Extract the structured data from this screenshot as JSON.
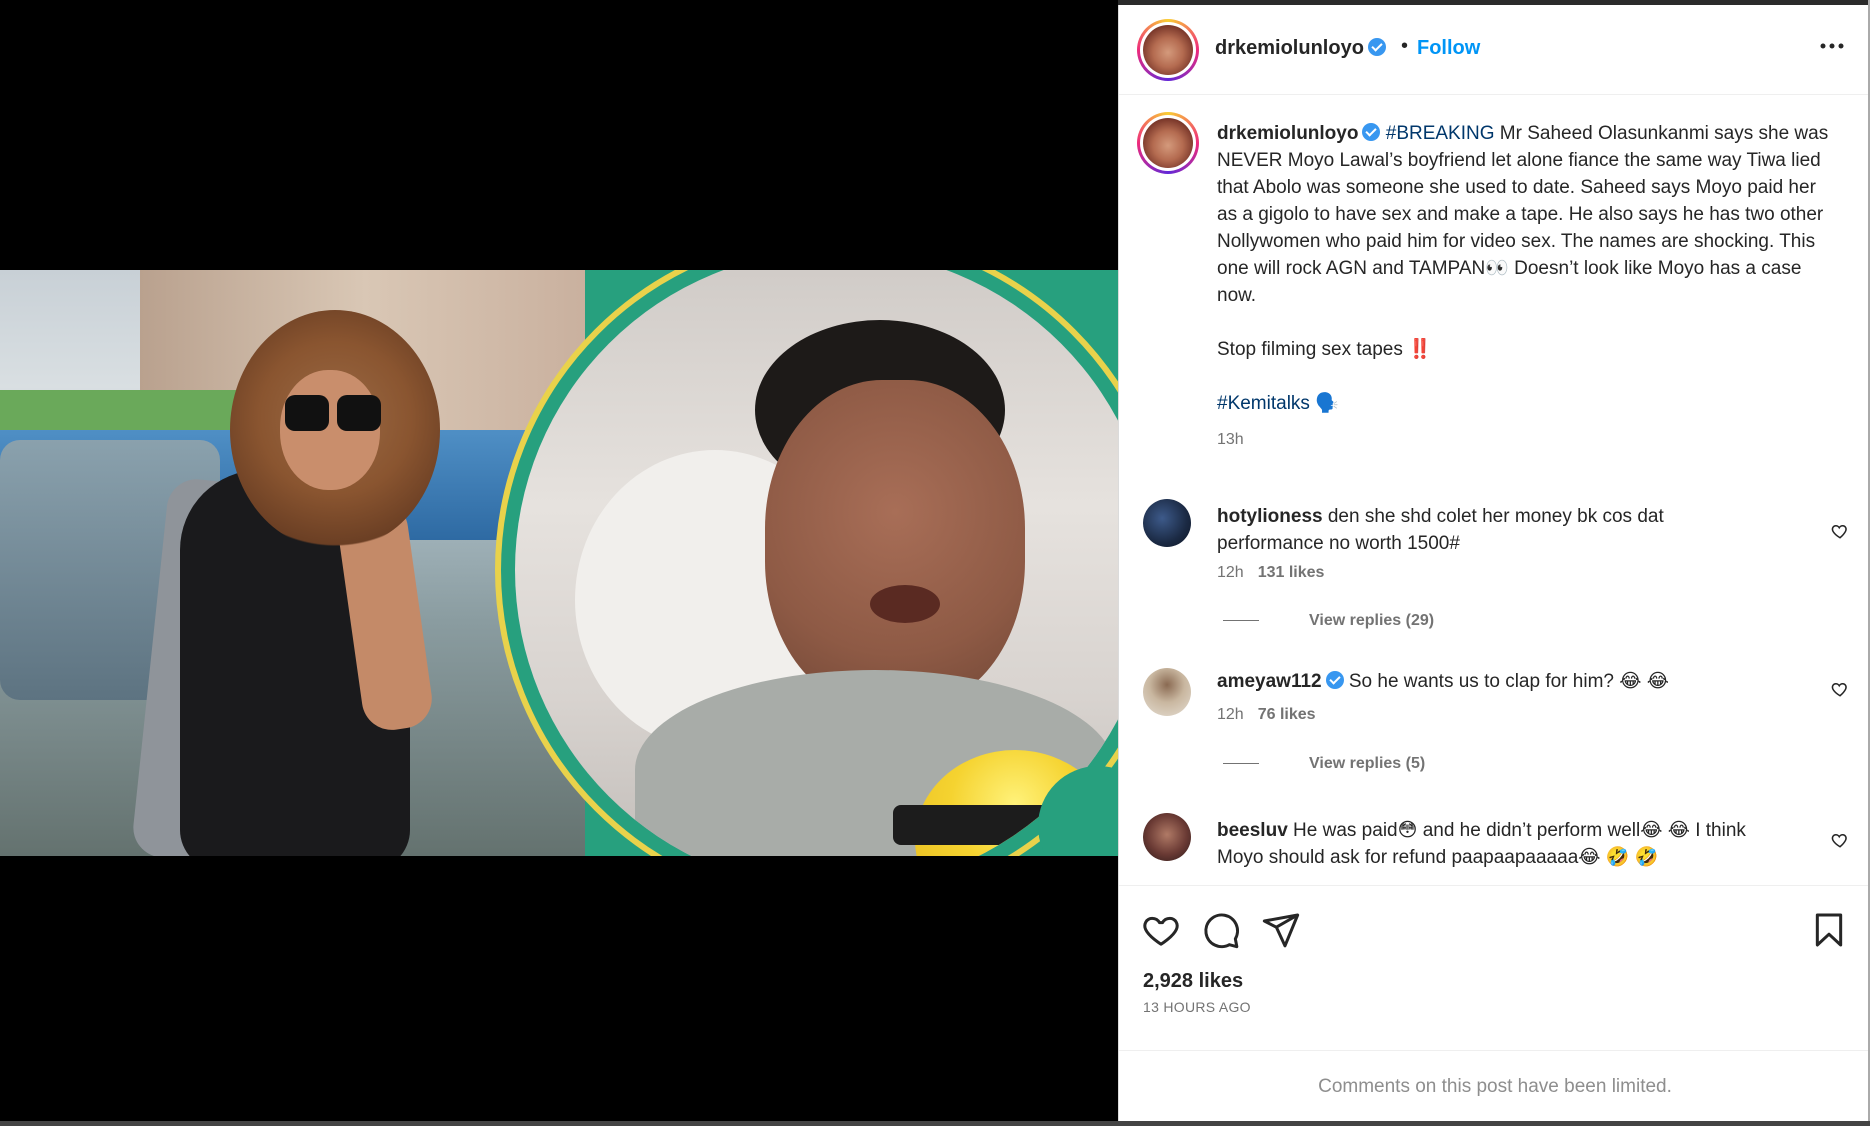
{
  "post": {
    "username": "drkemiolunloyo",
    "follow_label": "Follow",
    "separator": "•",
    "more_label": "•••",
    "caption": {
      "hashtag_breaking": "#BREAKING",
      "body": " Mr Saheed Olasunkanmi says she was NEVER Moyo Lawal’s boyfriend let alone fiance the same way Tiwa lied that Abolo was someone she used to date. Saheed says Moyo paid her as a gigolo to have sex and make a tape. He also says he has two other Nollywomen who paid him for video sex. The names are shocking. This one will rock AGN and TAMPAN👀  Doesn’t look like Moyo has a case now.",
      "line2": "Stop filming sex tapes ‼️",
      "hashtag2": "#Kemitalks 🗣️",
      "time": "13h"
    },
    "comments": [
      {
        "username": "hotylioness",
        "verified": false,
        "text": "den she shd colet her money bk cos dat performance no worth 1500#",
        "time": "12h",
        "likes": "131 likes",
        "replies": "View replies (29)"
      },
      {
        "username": "ameyaw112",
        "verified": true,
        "text": "So he wants us to clap for him? 😂 😂",
        "time": "12h",
        "likes": "76 likes",
        "replies": "View replies (5)"
      },
      {
        "username": "beesluv",
        "verified": false,
        "text": "He was paid😳  and he didn’t perform well😂 😂  I think Moyo should ask for refund paapaapaaaaa😂 🤣 🤣"
      }
    ],
    "likes_total": "2,928 likes",
    "time_ago": "13 HOURS AGO",
    "comments_limited": "Comments on this post have been limited."
  },
  "colors": {
    "link_blue": "#0095f6",
    "hashtag": "#00376b",
    "muted": "#737373",
    "verified": "#3897f0",
    "image_bg": "#27a07e"
  },
  "icons": [
    "verified-badge-icon",
    "more-options-icon",
    "heart-icon",
    "comment-icon",
    "share-icon",
    "bookmark-icon"
  ]
}
